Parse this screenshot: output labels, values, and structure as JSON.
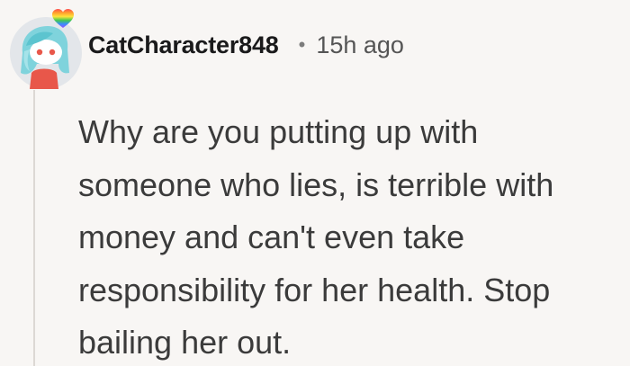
{
  "comment": {
    "username": "CatCharacter848",
    "separator": "•",
    "timestamp": "15h ago",
    "body_lines": [
      "Why are you putting up with",
      "someone who lies, is terrible with",
      "money and can't even take",
      "responsibility for her health. Stop",
      "bailing her out."
    ],
    "avatar_icon": "snoo-avatar-cyan-hair",
    "badge_icon": "rainbow-heart-icon"
  },
  "colors": {
    "background": "#f8f6f4",
    "username": "#1a1a1b",
    "meta": "#555555",
    "body": "#3b3b3b",
    "thread_line": "#dcd8d4"
  }
}
